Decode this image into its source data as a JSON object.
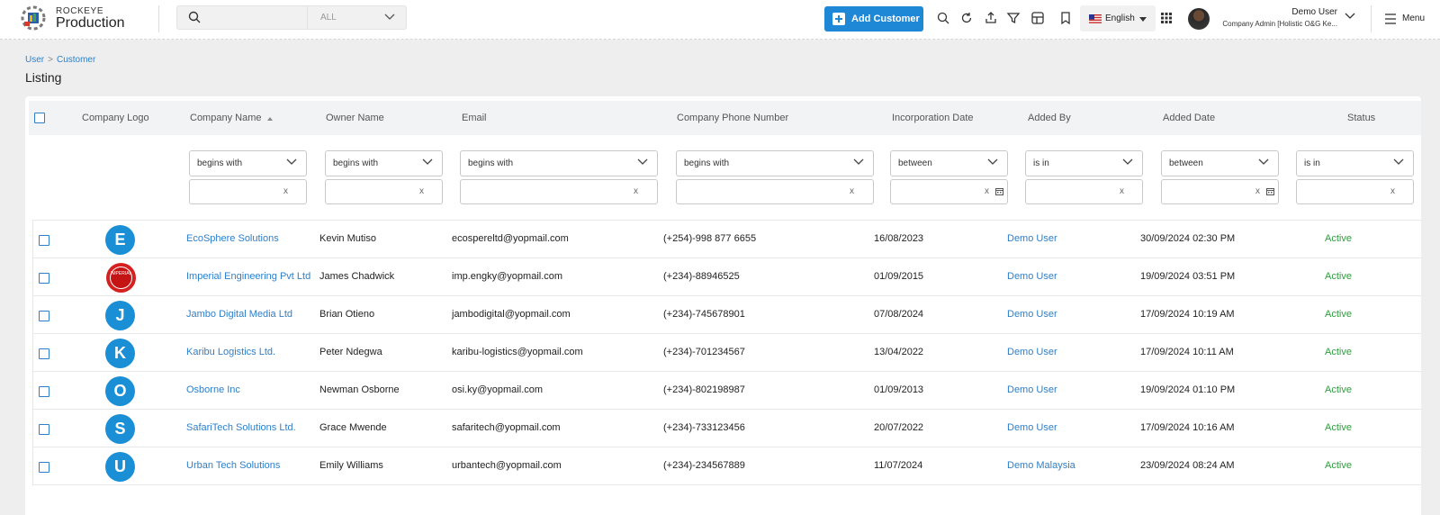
{
  "brand": {
    "small": "ROCKEYE",
    "big": "Production"
  },
  "search": {
    "placeholder": "",
    "scope": "ALL"
  },
  "header": {
    "add_button": "Add Customer",
    "language": "English",
    "user_name": "Demo User",
    "user_role": "Company Admin [Holistic O&G Ke...",
    "menu_label": "Menu"
  },
  "icons": [
    "search-icon",
    "refresh-icon",
    "upload-icon",
    "filter-icon",
    "layout-icon",
    "bookmark-icon",
    "apps-grid-icon",
    "menu-icon"
  ],
  "breadcrumb": {
    "root": "User",
    "sep": ">",
    "current": "Customer"
  },
  "page_title": "Listing",
  "table": {
    "columns": [
      "Company Logo",
      "Company Name",
      "Owner Name",
      "Email",
      "Company Phone Number",
      "Incorporation Date",
      "Added By",
      "Added Date",
      "Status"
    ],
    "filters": [
      "begins with",
      "begins with",
      "begins with",
      "begins with",
      "between",
      "is in",
      "between",
      "is in"
    ],
    "rows": [
      {
        "logo": "E",
        "company": "EcoSphere Solutions",
        "owner": "Kevin Mutiso",
        "email": "ecospereltd@yopmail.com",
        "phone": "(+254)-998 877 6655",
        "inc_date": "16/08/2023",
        "added_by": "Demo User",
        "added_date": "30/09/2024 02:30 PM",
        "status": "Active"
      },
      {
        "logo": "IMPERIAL",
        "company": "Imperial Engineering Pvt Ltd",
        "owner": "James Chadwick",
        "email": "imp.engky@yopmail.com",
        "phone": "(+234)-88946525",
        "inc_date": "01/09/2015",
        "added_by": "Demo User",
        "added_date": "19/09/2024 03:51 PM",
        "status": "Active"
      },
      {
        "logo": "J",
        "company": "Jambo Digital Media Ltd",
        "owner": "Brian Otieno",
        "email": "jambodigital@yopmail.com",
        "phone": "(+234)-745678901",
        "inc_date": "07/08/2024",
        "added_by": "Demo User",
        "added_date": "17/09/2024 10:19 AM",
        "status": "Active"
      },
      {
        "logo": "K",
        "company": "Karibu Logistics Ltd.",
        "owner": "Peter Ndegwa",
        "email": "karibu-logistics@yopmail.com",
        "phone": "(+234)-701234567",
        "inc_date": "13/04/2022",
        "added_by": "Demo User",
        "added_date": "17/09/2024 10:11 AM",
        "status": "Active"
      },
      {
        "logo": "O",
        "company": "Osborne Inc",
        "owner": "Newman Osborne",
        "email": "osi.ky@yopmail.com",
        "phone": "(+234)-802198987",
        "inc_date": "01/09/2013",
        "added_by": "Demo User",
        "added_date": "19/09/2024 01:10 PM",
        "status": "Active"
      },
      {
        "logo": "S",
        "company": "SafariTech Solutions Ltd.",
        "owner": "Grace Mwende",
        "email": "safaritech@yopmail.com",
        "phone": "(+234)-733123456",
        "inc_date": "20/07/2022",
        "added_by": "Demo User",
        "added_date": "17/09/2024 10:16 AM",
        "status": "Active"
      },
      {
        "logo": "U",
        "company": "Urban Tech Solutions",
        "owner": "Emily Williams",
        "email": "urbantech@yopmail.com",
        "phone": "(+234)-234567889",
        "inc_date": "11/07/2024",
        "added_by": "Demo Malaysia",
        "added_date": "23/09/2024 08:24 AM",
        "status": "Active"
      }
    ]
  },
  "colors": {
    "accent": "#1e88d6",
    "link": "#2f7fc8",
    "status_active": "#2e9e3e",
    "logo_circle": "#1a8fd6"
  }
}
